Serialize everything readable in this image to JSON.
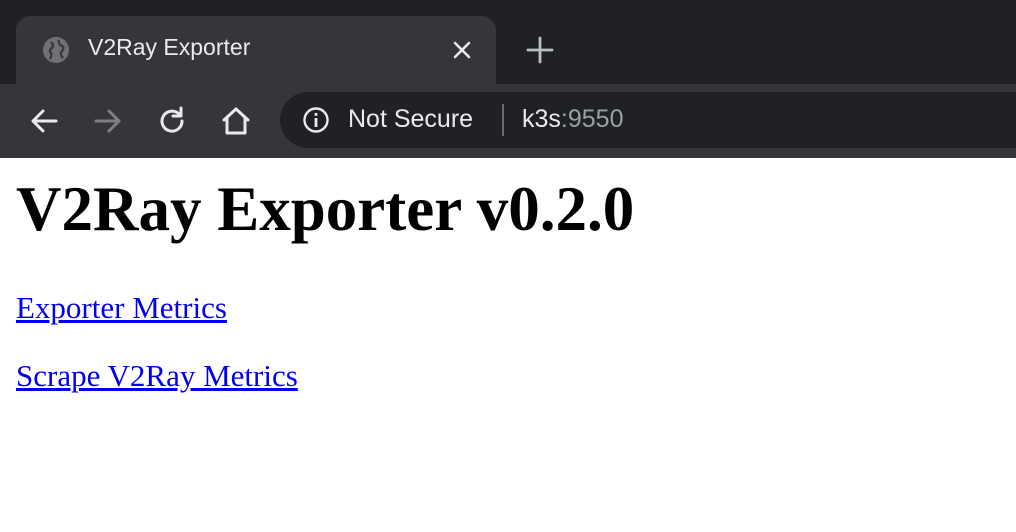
{
  "browser": {
    "tab": {
      "title": "V2Ray Exporter",
      "favicon": "globe-icon"
    },
    "toolbar": {
      "back": "back-arrow-icon",
      "forward": "forward-arrow-icon",
      "reload": "reload-icon",
      "home": "home-icon"
    },
    "omnibox": {
      "security_label": "Not Secure",
      "url_host": "k3s",
      "url_rest": ":9550"
    },
    "colors": {
      "tabstrip": "#202124",
      "toolbar": "#35363a",
      "omnibox": "#202124",
      "link": "#0000ee"
    }
  },
  "page": {
    "title": "V2Ray Exporter v0.2.0",
    "links": [
      {
        "label": "Exporter Metrics"
      },
      {
        "label": "Scrape V2Ray Metrics"
      }
    ]
  }
}
